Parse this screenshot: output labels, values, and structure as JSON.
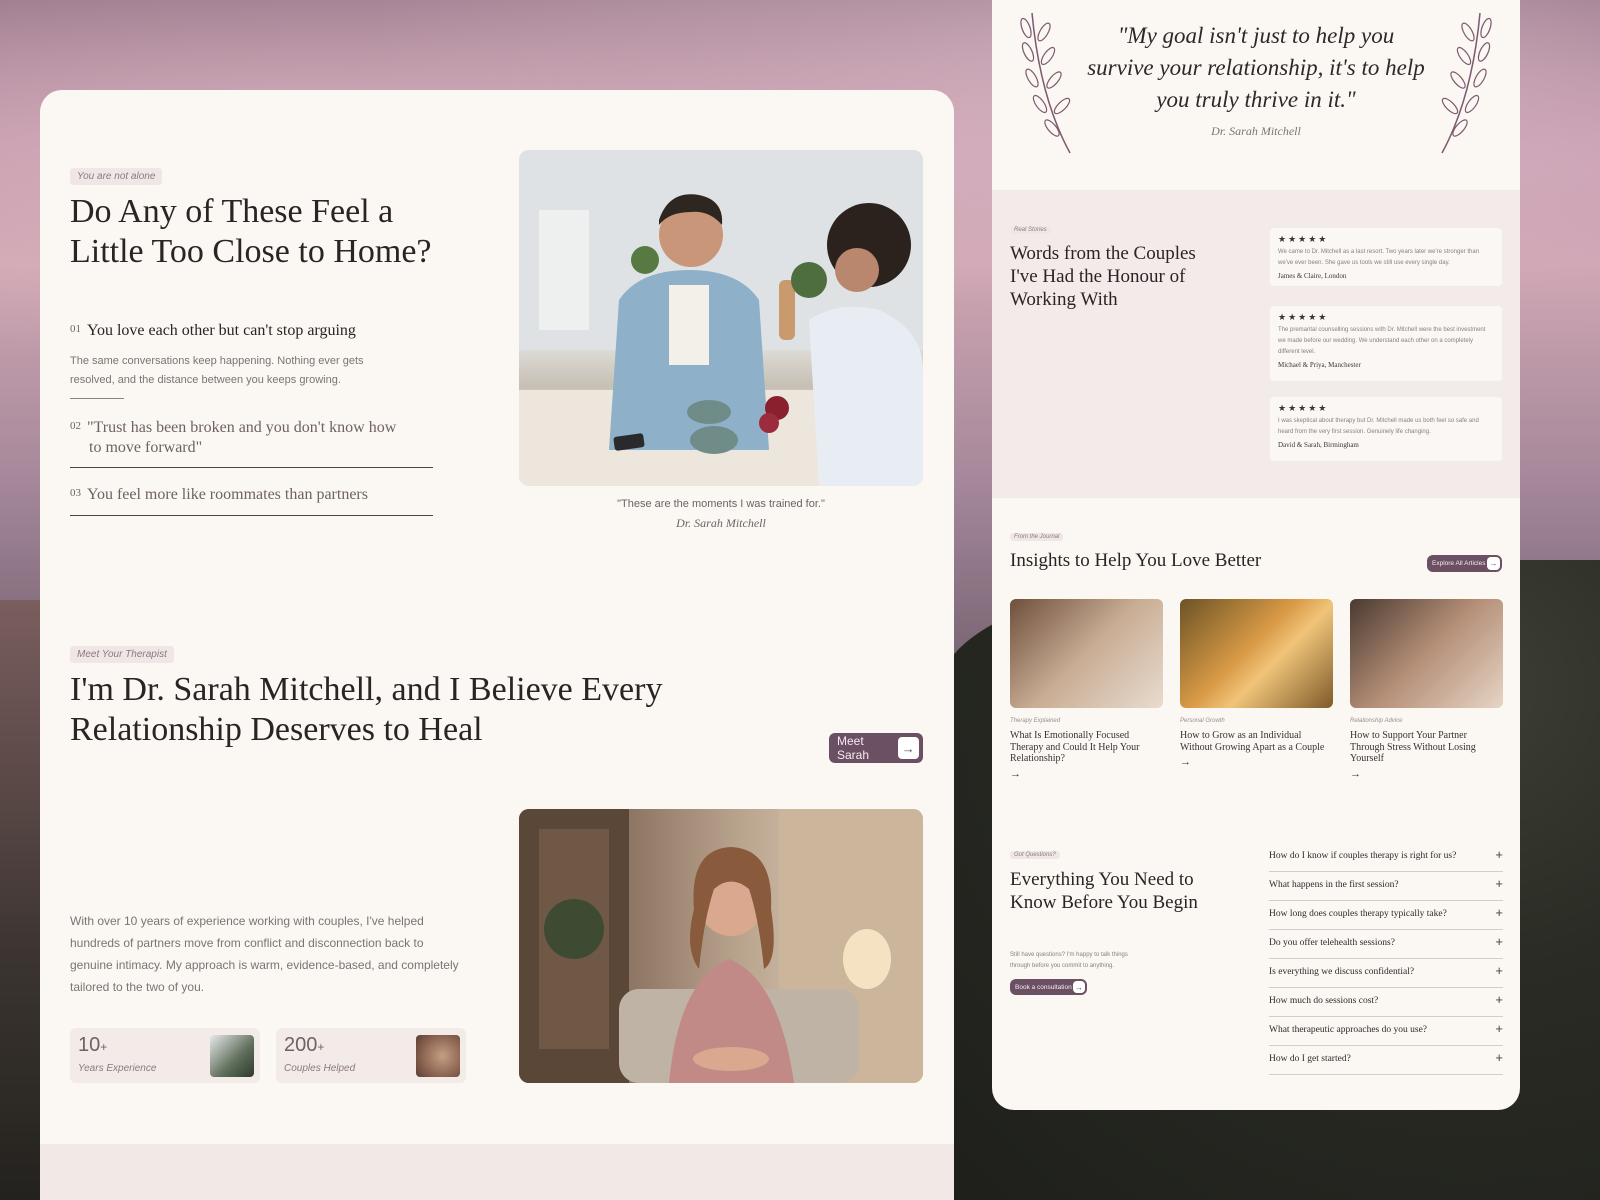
{
  "pain_section": {
    "tag": "You are not alone",
    "title_line1": "Do Any of These Feel a",
    "title_line2": "Little Too Close to Home?",
    "items": [
      {
        "num": "01",
        "title": "You love each other but can't stop arguing",
        "desc_line1": "The same conversations keep happening. Nothing ever gets",
        "desc_line2": "resolved, and the distance between you keeps growing."
      },
      {
        "num": "02",
        "title_line1": "\"Trust has been broken and you don't know how",
        "title_line2": "to move forward\""
      },
      {
        "num": "03",
        "title": "You feel more like roommates than partners"
      }
    ],
    "photo_caption": "\"These are the moments I was trained for.\"",
    "photo_signature": "Dr. Sarah Mitchell"
  },
  "therapist_section": {
    "tag": "Meet Your Therapist",
    "title_line1": "I'm Dr. Sarah Mitchell, and I Believe Every",
    "title_line2": "Relationship Deserves to Heal",
    "cta_label": "Meet Sarah",
    "bio_lines": [
      "With over 10 years of experience working with couples, I've helped",
      "hundreds of partners move from conflict and disconnection back to",
      "genuine intimacy. My approach is warm, evidence-based, and completely",
      "tailored to the two of you."
    ],
    "stats": [
      {
        "value": "10",
        "suffix": "+",
        "label": "Years Experience"
      },
      {
        "value": "200",
        "suffix": "+",
        "label": "Couples Helped"
      }
    ]
  },
  "quote_section": {
    "line1": "\"My goal isn't just to help you",
    "line2": "survive your relationship, it's to help",
    "line3": "you truly thrive in it.\"",
    "signature": "Dr. Sarah Mitchell"
  },
  "reviews_section": {
    "tag": "Real Stories",
    "title_line1": "Words from the Couples",
    "title_line2": "I've Had the Honour of",
    "title_line3": "Working With",
    "stars": "★★★★★",
    "reviews": [
      {
        "text_line1": "We came to Dr. Mitchell as a last resort. Two years later we're stronger than",
        "text_line2": "we've ever been. She gave us tools we still use every single day.",
        "text_line3": "",
        "name": "James & Claire, London"
      },
      {
        "text_line1": "The premarital counselling sessions with Dr. Mitchell were the best investment",
        "text_line2": "we made before our wedding. We understand each other on a completely",
        "text_line3": "different level.",
        "name": "Michael & Priya, Manchester"
      },
      {
        "text_line1": "I was skeptical about therapy but Dr. Mitchell made us both feel so safe and",
        "text_line2": "heard from the very first session. Genuinely life changing.",
        "text_line3": "",
        "name": "David & Sarah, Birmingham"
      }
    ]
  },
  "journal_section": {
    "tag": "From the Journal",
    "title": "Insights to Help You Love Better",
    "cta_label": "Explore All Articles",
    "articles": [
      {
        "category": "Therapy Explained",
        "title": "What Is Emotionally Focused Therapy and Could It Help Your Relationship?"
      },
      {
        "category": "Personal Growth",
        "title": "How to Grow as an Individual Without Growing Apart as a Couple"
      },
      {
        "category": "Relationship Advice",
        "title": "How to Support Your Partner Through Stress Without Losing Yourself"
      }
    ]
  },
  "faq_section": {
    "tag": "Got Questions?",
    "title_line1": "Everything You Need to",
    "title_line2": "Know Before You Begin",
    "sub_line1": "Still have questions? I'm happy to talk things",
    "sub_line2": "through before you commit to anything.",
    "cta_label": "Book a consultation",
    "questions": [
      "How do I know if couples therapy is right for us?",
      "What happens in the first session?",
      "How long does couples therapy typically take?",
      "Do you offer telehealth sessions?",
      "Is everything we discuss confidential?",
      "How much do sessions cost?",
      "What therapeutic approaches do you use?",
      "How do I get started?"
    ]
  },
  "icons": {
    "arrow": "arrow-right-icon",
    "plus": "plus-icon",
    "star": "star-icon",
    "laurel": "laurel-branch-icon"
  },
  "colors": {
    "primary": "#6b4f63",
    "background": "#fbf7f2",
    "text": "#2b2324",
    "muted": "#7d7374",
    "soft_panel": "#f3eaea"
  }
}
